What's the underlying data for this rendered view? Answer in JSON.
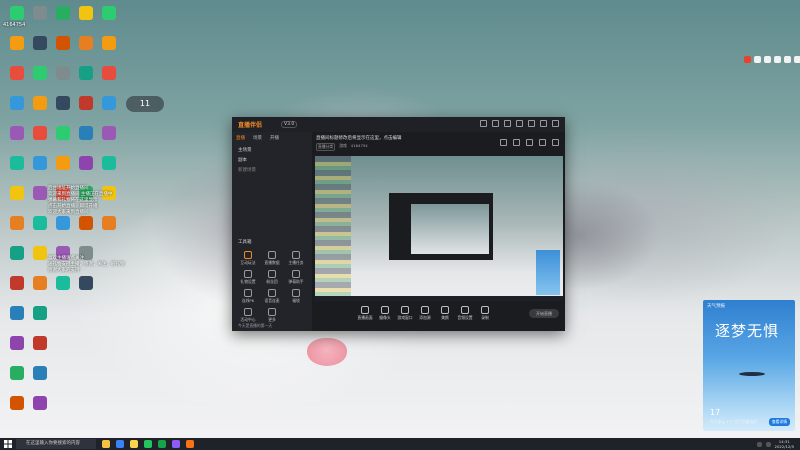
{
  "desktop": {
    "top_left_label": "4164754",
    "clock_widget": "11"
  },
  "chat_overlay": [
    "后台地址开始直播间",
    "欢迎来到直播间 主播正在直播中",
    "弹幕和礼物将在这里显示",
    "点击开始直播，即可开播",
    "欢迎大家来到直播间",
    "喜欢主播请点关注",
    "送礼物支持主播，感谢，关注，刷礼物",
    "感谢大家的支持"
  ],
  "app": {
    "logo": "直播伴侣",
    "version": "V3.0",
    "sidebar_tabs": [
      "直播",
      "场景",
      "开播"
    ],
    "scenes": [
      "主场景",
      "副本",
      "新建场景"
    ],
    "tools_label": "工具箱",
    "tools": [
      "互动玩法",
      "直播数据",
      "主播任务",
      "礼物设置",
      "粉丝团",
      "弹幕助手",
      "连线PK",
      "语音连麦",
      "福袋",
      "活动中心",
      "更多"
    ],
    "sidebar_footer": "今天是直播的第一天",
    "stream_title": "直播间标题修改后将显示在这里，点击编辑",
    "stream_meta": [
      "直播分类",
      "游戏",
      "4164754"
    ],
    "controls": [
      "直播画面",
      "摄像头",
      "游戏窗口",
      "添加源",
      "美颜",
      "音频设置",
      "录制"
    ],
    "start_button": "开始直播"
  },
  "weather": {
    "header": "天气预报",
    "slogan": "逐梦无惧",
    "temperature": "17",
    "description": "今天多云 17° 空气质量良好",
    "button": "查看详情"
  },
  "taskbar": {
    "search_placeholder": "在这里输入你要搜索的内容",
    "time": "14:31",
    "date": "2022/12/5"
  }
}
